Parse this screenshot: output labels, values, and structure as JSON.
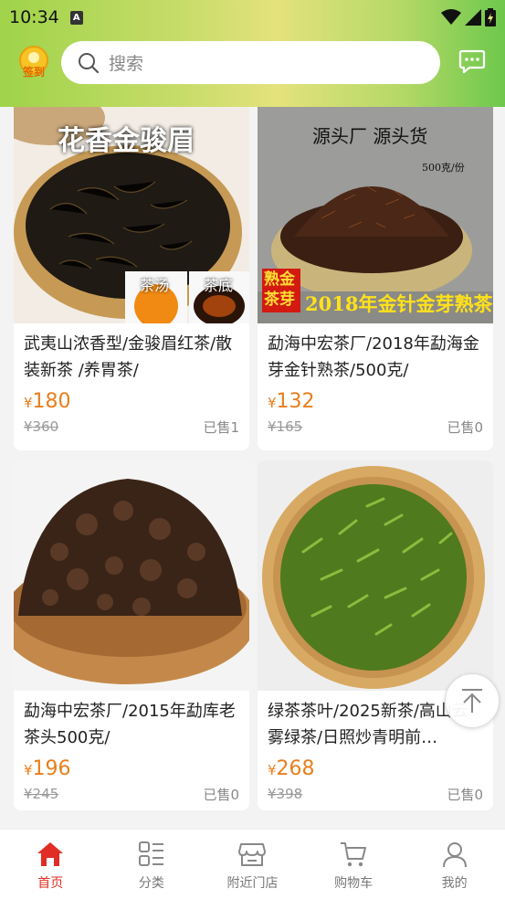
{
  "status_bar": {
    "time": "10:34",
    "notif_icon": "A"
  },
  "header": {
    "signin_label": "签到",
    "search_placeholder": "搜索"
  },
  "products": [
    {
      "title": "武夷山浓香型/金骏眉红茶/散装新茶 /养胃茶/",
      "price": "180",
      "original_price": "¥360",
      "sold": "已售1",
      "image_banner": "花香金骏眉",
      "image_tag1": "茶汤",
      "image_tag2": "茶底"
    },
    {
      "title": "勐海中宏茶厂/2018年勐海金芽金针熟茶/500克/",
      "price": "132",
      "original_price": "¥165",
      "sold": "已售0",
      "image_banner": "源头厂 源头货",
      "image_weight": "500克/份",
      "image_badge": "熟金茶芽",
      "image_caption": "2018年金针金芽熟茶"
    },
    {
      "title": "勐海中宏茶厂/2015年勐库老茶头500克/",
      "price": "196",
      "original_price": "¥245",
      "sold": "已售0"
    },
    {
      "title": "绿茶茶叶/2025新茶/高山云雾绿茶/日照炒青明前…",
      "price": "268",
      "original_price": "¥398",
      "sold": "已售0"
    }
  ],
  "currency": "¥",
  "nav": {
    "items": [
      {
        "label": "首页",
        "icon": "home-icon",
        "active": true
      },
      {
        "label": "分类",
        "icon": "category-icon"
      },
      {
        "label": "附近门店",
        "icon": "store-icon"
      },
      {
        "label": "购物车",
        "icon": "cart-icon"
      },
      {
        "label": "我的",
        "icon": "user-icon"
      }
    ]
  },
  "colors": {
    "price": "#e87e1d",
    "nav_active": "#e02e24",
    "header_gradient_start": "#9fd34a",
    "header_gradient_end": "#6dc84c"
  }
}
